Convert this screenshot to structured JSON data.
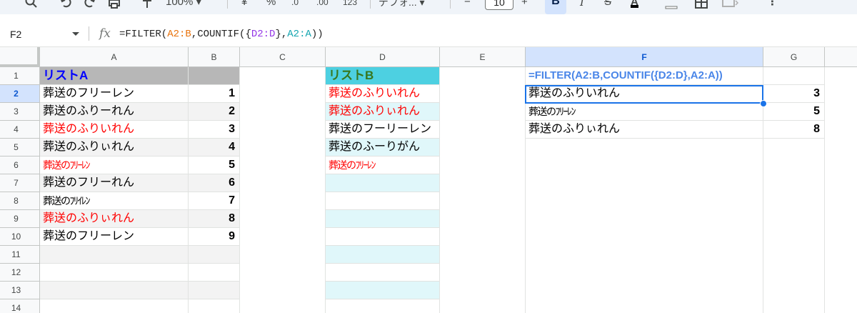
{
  "toolbar": {
    "zoom": "100%",
    "currency": "¥",
    "percent": "%",
    "decrease_decimal": ".0",
    "increase_decimal": ".00",
    "number_format": "123",
    "font_name": "デフォ...",
    "font_minus": "−",
    "font_size": "10",
    "font_plus": "+",
    "bold": "B",
    "italic": "I",
    "strike": "S",
    "text_color": "A"
  },
  "formula_bar": {
    "name_box": "F2",
    "fx": "fx",
    "parts": [
      "=FILTER(",
      "A2:B",
      ",COUNTIF({",
      "D2:D",
      "},",
      "A2:A",
      "))"
    ]
  },
  "columns": [
    "A",
    "B",
    "C",
    "D",
    "E",
    "F",
    "G"
  ],
  "rows": [
    "1",
    "2",
    "3",
    "4",
    "5",
    "6",
    "7",
    "8",
    "9",
    "10",
    "11",
    "12",
    "13",
    "14"
  ],
  "list_a": {
    "header": "リストA",
    "items": [
      {
        "text": "葬送のフリーレン",
        "num": "1"
      },
      {
        "text": "葬送のふりーれん",
        "num": "2"
      },
      {
        "text": "葬送のふりいれん",
        "num": "3"
      },
      {
        "text": "葬送のふりぃれん",
        "num": "4"
      },
      {
        "text": "葬送のﾌﾘｰﾚﾝ",
        "num": "5"
      },
      {
        "text": "葬送のフリーれん",
        "num": "6"
      },
      {
        "text": "葬送のﾌﾘｲﾚﾝ",
        "num": "7"
      },
      {
        "text": "葬送のふりぃれん",
        "num": "8"
      },
      {
        "text": "葬送のフリーレン",
        "num": "9"
      }
    ]
  },
  "list_b": {
    "header": "リストB",
    "items": [
      "葬送のふりいれん",
      "葬送のふりぃれん",
      "葬送のフーリーレン",
      "葬送のふーりがん",
      "葬送のﾌﾘｰﾚﾝ"
    ]
  },
  "result": {
    "formula": "=FILTER(A2:B,COUNTIF({D2:D},A2:A))",
    "rows": [
      {
        "text": "葬送のふりいれん",
        "num": "3"
      },
      {
        "text": "葬送のﾌﾘｰﾚﾝ",
        "num": "5"
      },
      {
        "text": "葬送のふりぃれん",
        "num": "8"
      }
    ]
  },
  "colors": {
    "accent": "#1a73e8",
    "list_a_header_bg": "#b7b7b7",
    "list_b_header_bg": "#4dd0e1",
    "highlight_text": "#ff0000",
    "formula_text": "#4a86e8"
  }
}
